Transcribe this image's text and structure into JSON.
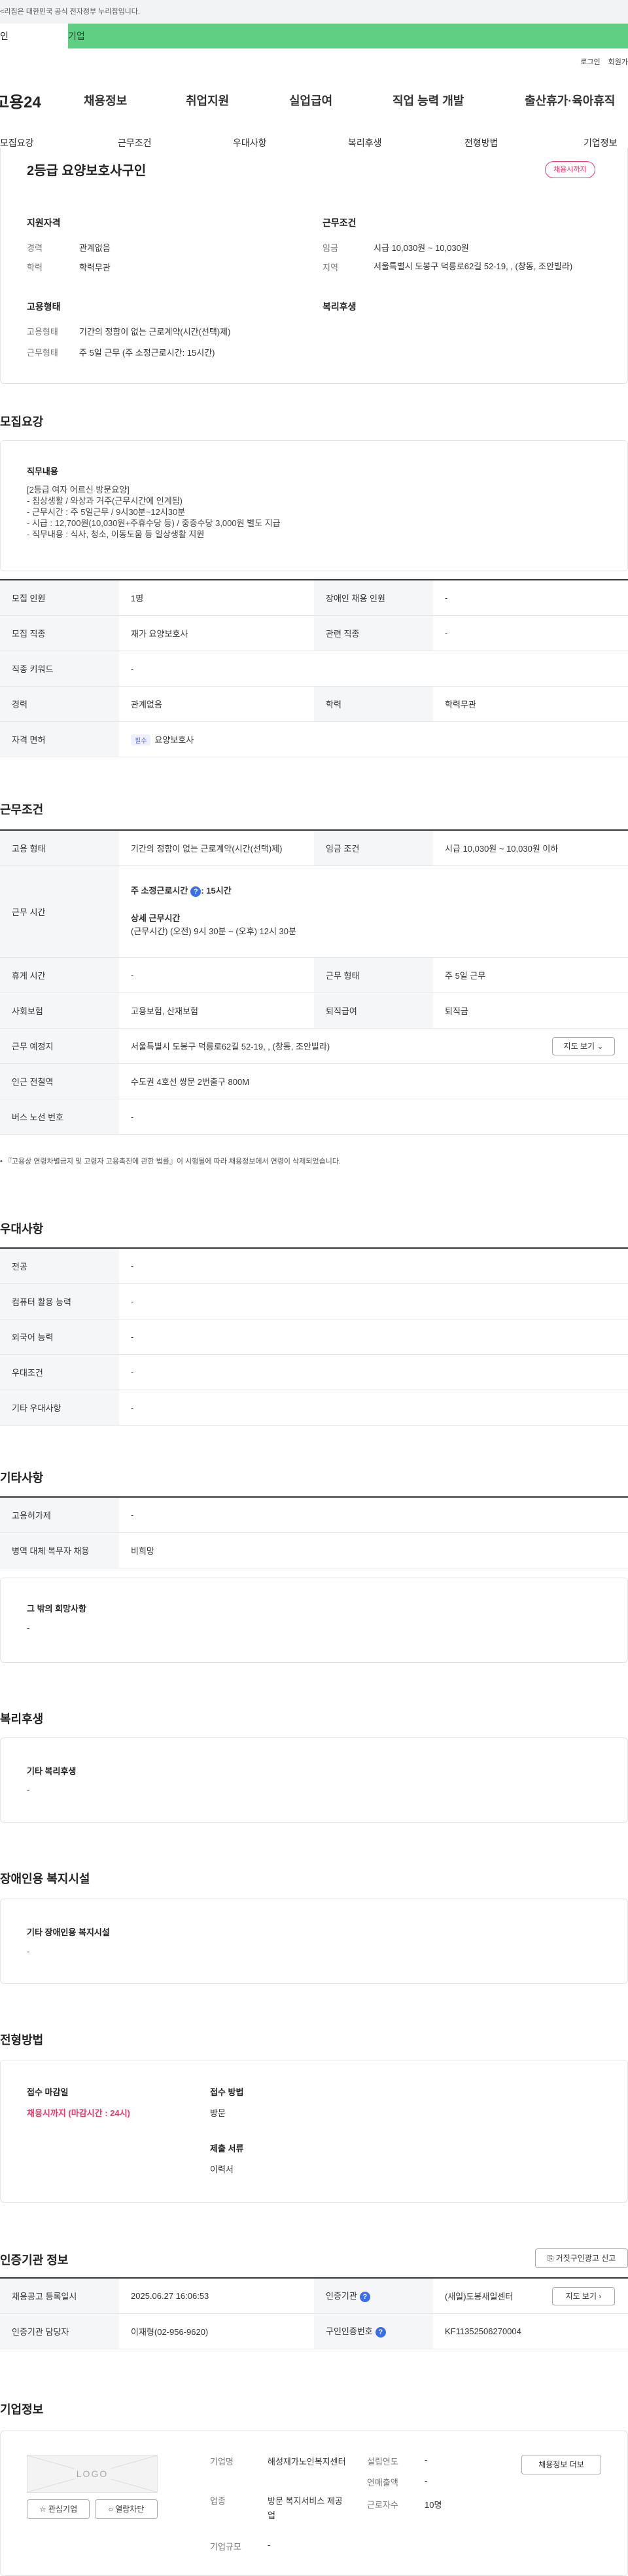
{
  "gov_banner": {
    "text": "<리집은 대한민국 공식 전자정부 누리집입니다."
  },
  "service_tabs": [
    "인",
    "기업"
  ],
  "util_links": [
    "로그인",
    "회원가"
  ],
  "header": {
    "logo": "고용24",
    "menu": [
      "채용정보",
      "취업지원",
      "실업급여",
      "직업 능력 개발",
      "출산휴가·육아휴직"
    ]
  },
  "anchors": [
    "모집요강",
    "근무조건",
    "우대사항",
    "복리후생",
    "전형방법",
    "기업정보"
  ],
  "summary": {
    "title": "2등급 요양보호사구인",
    "badge": "채용시까지",
    "qual_heading": "지원자격",
    "qual": [
      {
        "label": "경력",
        "value": "관계없음"
      },
      {
        "label": "학력",
        "value": "학력무관"
      }
    ],
    "cond_heading": "근무조건",
    "cond": [
      {
        "label": "임금",
        "value": "시급 10,030원 ~ 10,030원"
      },
      {
        "label": "지역",
        "value": "서울특별시 도봉구 덕릉로62길 52-19, , (창동, 조안빌라)"
      }
    ],
    "emp_heading": "고용형태",
    "emp": [
      {
        "label": "고용형태",
        "value": "기간의 정함이 없는 근로계약(시간(선택)제)"
      },
      {
        "label": "근무형태",
        "value": "주 5일 근무 (주 소정근로시간: 15시간)"
      }
    ],
    "welfare_heading": "복리후생"
  },
  "recruit": {
    "heading": "모집요강",
    "duty_heading": "직무내용",
    "duty_lines": [
      "[2등급 여자 어르신 방문요양]",
      "- 침상생활 / 와상과 거주(근무시간에 인계됨)",
      "- 근무시간 : 주 5일근무 / 9시30분~12시30분",
      "- 시급 : 12,700원(10,030원+주휴수당 등) / 중증수당 3,000원 별도 지급",
      "- 직무내용 : 식사, 청소, 이동도움 등 일상생활 지원"
    ],
    "rows": [
      {
        "l1": "모집 인원",
        "v1": "1명",
        "l2": "장애인 채용 인원",
        "v2": "-"
      },
      {
        "l1": "모집 직종",
        "v1": "재가 요양보호사",
        "l2": "관련 직종",
        "v2": "-"
      },
      {
        "l1": "직종 키워드",
        "v1": "-"
      },
      {
        "l1": "경력",
        "v1": "관계없음",
        "l2": "학력",
        "v2": "학력무관"
      },
      {
        "l1": "자격 면허",
        "tag": "필수",
        "v1": "요양보호사"
      }
    ]
  },
  "work": {
    "heading": "근무조건",
    "emp_label": "고용 형태",
    "emp_value": "기간의 정함이 없는 근로계약(시간(선택)제)",
    "wage_label": "임금 조건",
    "wage_value": "시급 10,030원 ~ 10,030원 이하",
    "hours_label": "근무 시간",
    "hours_weekly": "주 소정근로시간",
    "hours_weekly_val": ": 15시간",
    "hours_detail_title": "상세 근무시간",
    "hours_detail": "(근무시간) (오전) 9시 30분 ~ (오후) 12시 30분",
    "break_label": "휴게 시간",
    "break_value": "-",
    "form_label": "근무 형태",
    "form_value": "주 5일 근무",
    "ins_label": "사회보험",
    "ins_value": "고용보험, 산재보험",
    "ret_label": "퇴직급여",
    "ret_value": "퇴직금",
    "place_label": "근무 예정지",
    "place_value": "서울특별시 도봉구 덕릉로62길 52-19, , (창동, 조안빌라)",
    "map_btn": "지도 보기",
    "station_label": "인근 전철역",
    "station_value": "수도권 4호선 쌍문 2번출구 800M",
    "bus_label": "버스 노선 번호",
    "bus_value": "-",
    "note": "『고용상 연령차별금지 및 고령자 고용촉진에 관한 법률』이 시행될에 따라 채용정보에서 연령이 삭제되었습니다."
  },
  "pref": {
    "heading": "우대사항",
    "rows": [
      {
        "l": "전공",
        "v": "-"
      },
      {
        "l": "컴퓨터 활용 능력",
        "v": "-"
      },
      {
        "l": "외국어 능력",
        "v": "-"
      },
      {
        "l": "우대조건",
        "v": "-"
      },
      {
        "l": "기타 우대사항",
        "v": "-"
      }
    ]
  },
  "etc": {
    "heading": "기타사항",
    "rows": [
      {
        "l": "고용허가제",
        "v": "-"
      },
      {
        "l": "병역 대체 복무자 채용",
        "v": "비희망"
      }
    ],
    "box_title": "그 밖의 희망사항",
    "box_value": "-"
  },
  "welfare": {
    "heading": "복리후생",
    "box_title": "기타 복리후생",
    "box_value": "-"
  },
  "disab": {
    "heading": "장애인용 복지시설",
    "box_title": "기타 장애인용 복지시설",
    "box_value": "-"
  },
  "select": {
    "heading": "전형방법",
    "deadline_label": "접수 마감일",
    "deadline_value": "채용시까지 (마감시간 : 24시)",
    "method_label": "접수 방법",
    "method_value": "방문",
    "docs_label": "제출 서류",
    "docs_value": "이력서"
  },
  "cert": {
    "heading": "인증기관 정보",
    "report_btn": "거짓구인광고 신고",
    "reg_label": "채용공고 등록일시",
    "reg_value": "2025.06.27 16:06:53",
    "org_label": "인증기관",
    "org_value": "(새일)도봉새일센터",
    "map_btn": "지도 보기",
    "mgr_label": "인증기관 담당자",
    "mgr_value": "이재형(02-956-9620)",
    "id_label": "구인인증번호",
    "id_value": "KF11352506270004"
  },
  "company": {
    "heading": "기업정보",
    "logo_text": "LOGO",
    "fav_btn": "관심기업",
    "block_btn": "열람차단",
    "name_label": "기업명",
    "name_value": "해성재가노인복지센터",
    "year_label": "설립연도",
    "year_value": "-",
    "sales_label": "연매출액",
    "sales_value": "-",
    "industry_label": "업종",
    "industry_value": "방문 복지서비스 제공업",
    "staff_label": "근로자수",
    "staff_value": "10명",
    "size_label": "기업규모",
    "size_value": "-",
    "info_btn": "채용정보 더보"
  }
}
